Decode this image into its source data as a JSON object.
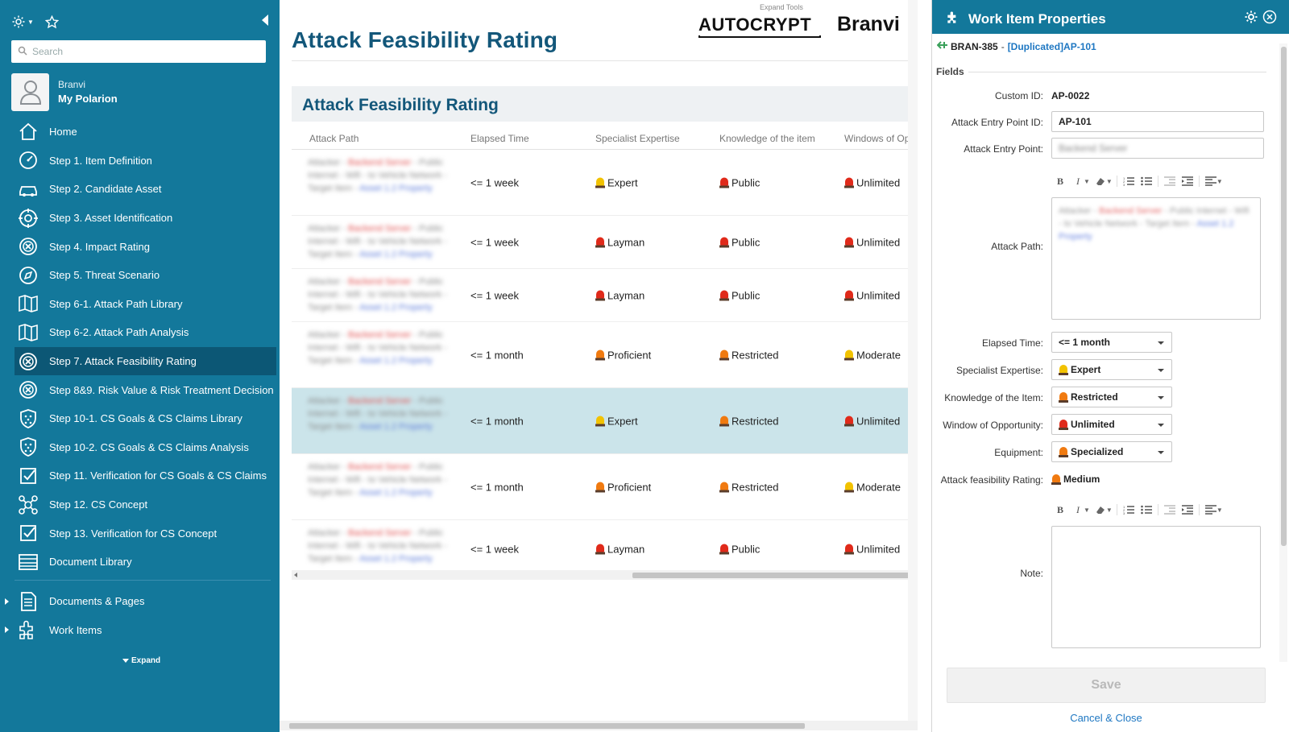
{
  "sidebar": {
    "search_placeholder": "Search",
    "user": {
      "name": "Branvi",
      "project": "My Polarion"
    },
    "items": [
      {
        "label": "Home",
        "icon": "home-icon"
      },
      {
        "label": "Step 1. Item Definition",
        "icon": "gauge-icon"
      },
      {
        "label": "Step 2. Candidate Asset",
        "icon": "car-icon"
      },
      {
        "label": "Step 3. Asset Identification",
        "icon": "target-icon"
      },
      {
        "label": "Step 4. Impact Rating",
        "icon": "circle-x-icon"
      },
      {
        "label": "Step 5. Threat Scenario",
        "icon": "compass-icon"
      },
      {
        "label": "Step 6-1. Attack Path Library",
        "icon": "map-icon"
      },
      {
        "label": "Step 6-2. Attack Path Analysis",
        "icon": "map-icon"
      },
      {
        "label": "Step 7. Attack Feasibility Rating",
        "icon": "circle-x-icon"
      },
      {
        "label": "Step 8&9. Risk Value & Risk Treatment Decision",
        "icon": "circle-x-icon"
      },
      {
        "label": "Step 10-1. CS Goals & CS Claims Library",
        "icon": "shield-icon"
      },
      {
        "label": "Step 10-2. CS Goals & CS Claims Analysis",
        "icon": "shield-icon"
      },
      {
        "label": "Step 11. Verification for CS Goals & CS Claims",
        "icon": "checklist-icon"
      },
      {
        "label": "Step 12. CS Concept",
        "icon": "network-icon"
      },
      {
        "label": "Step 13. Verification for CS Concept",
        "icon": "checklist-icon"
      },
      {
        "label": "Document Library",
        "icon": "library-icon"
      }
    ],
    "active_index": 8,
    "groups": [
      {
        "label": "Documents & Pages",
        "icon": "document-icon"
      },
      {
        "label": "Work Items",
        "icon": "puzzle-icon"
      }
    ],
    "expand_label": "Expand"
  },
  "main": {
    "title": "Attack Feasibility Rating",
    "expand_tools": "Expand Tools",
    "logo_left": "AUTOCRYPT",
    "logo_right": "Branvi",
    "section_title": "Attack Feasibility Rating",
    "columns": [
      "Attack Path",
      "Elapsed Time",
      "Specialist Expertise",
      "Knowledge of the item",
      "Windows of Op"
    ],
    "rows": [
      {
        "elapsed": "<= 1 week",
        "expertise": "Expert",
        "expertise_color": "#f2c200",
        "knowledge": "Public",
        "knowledge_color": "#e02a1a",
        "window": "Unlimited",
        "window_color": "#e02a1a",
        "height": 82,
        "selected": false
      },
      {
        "elapsed": "<= 1 week",
        "expertise": "Layman",
        "expertise_color": "#e02a1a",
        "knowledge": "Public",
        "knowledge_color": "#e02a1a",
        "window": "Unlimited",
        "window_color": "#e02a1a",
        "height": 66,
        "selected": false
      },
      {
        "elapsed": "<= 1 week",
        "expertise": "Layman",
        "expertise_color": "#e02a1a",
        "knowledge": "Public",
        "knowledge_color": "#e02a1a",
        "window": "Unlimited",
        "window_color": "#e02a1a",
        "height": 66,
        "selected": false
      },
      {
        "elapsed": "<= 1 month",
        "expertise": "Proficient",
        "expertise_color": "#f07a10",
        "knowledge": "Restricted",
        "knowledge_color": "#f07a10",
        "window": "Moderate",
        "window_color": "#f2c200",
        "height": 82,
        "selected": false
      },
      {
        "elapsed": "<= 1 month",
        "expertise": "Expert",
        "expertise_color": "#f2c200",
        "knowledge": "Restricted",
        "knowledge_color": "#f07a10",
        "window": "Unlimited",
        "window_color": "#e02a1a",
        "height": 82,
        "selected": true
      },
      {
        "elapsed": "<= 1 month",
        "expertise": "Proficient",
        "expertise_color": "#f07a10",
        "knowledge": "Restricted",
        "knowledge_color": "#f07a10",
        "window": "Moderate",
        "window_color": "#f2c200",
        "height": 82,
        "selected": false
      },
      {
        "elapsed": "<= 1 week",
        "expertise": "Layman",
        "expertise_color": "#e02a1a",
        "knowledge": "Public",
        "knowledge_color": "#e02a1a",
        "window": "Unlimited",
        "window_color": "#e02a1a",
        "height": 72,
        "selected": false
      }
    ]
  },
  "panel": {
    "title": "Work Item Properties",
    "item_id": "BRAN-385",
    "item_link": "[Duplicated]AP-101",
    "fields_label": "Fields",
    "custom_id_label": "Custom ID:",
    "custom_id": "AP-0022",
    "entry_point_id_label": "Attack Entry Point ID:",
    "entry_point_id": "AP-101",
    "entry_point_label": "Attack Entry Point:",
    "attack_path_label": "Attack Path:",
    "elapsed_label": "Elapsed Time:",
    "elapsed_value": "<= 1 month",
    "expertise_label": "Specialist Expertise:",
    "expertise_value": "Expert",
    "expertise_color": "#f2c200",
    "knowledge_label": "Knowledge of the Item:",
    "knowledge_value": "Restricted",
    "knowledge_color": "#f07a10",
    "window_label": "Window of Opportunity:",
    "window_value": "Unlimited",
    "window_color": "#e02a1a",
    "equipment_label": "Equipment:",
    "equipment_value": "Specialized",
    "equipment_color": "#f07a10",
    "rating_label": "Attack feasibility Rating:",
    "rating_value": "Medium",
    "rating_color": "#f07a10",
    "note_label": "Note:",
    "save_label": "Save",
    "cancel_label": "Cancel & Close"
  }
}
